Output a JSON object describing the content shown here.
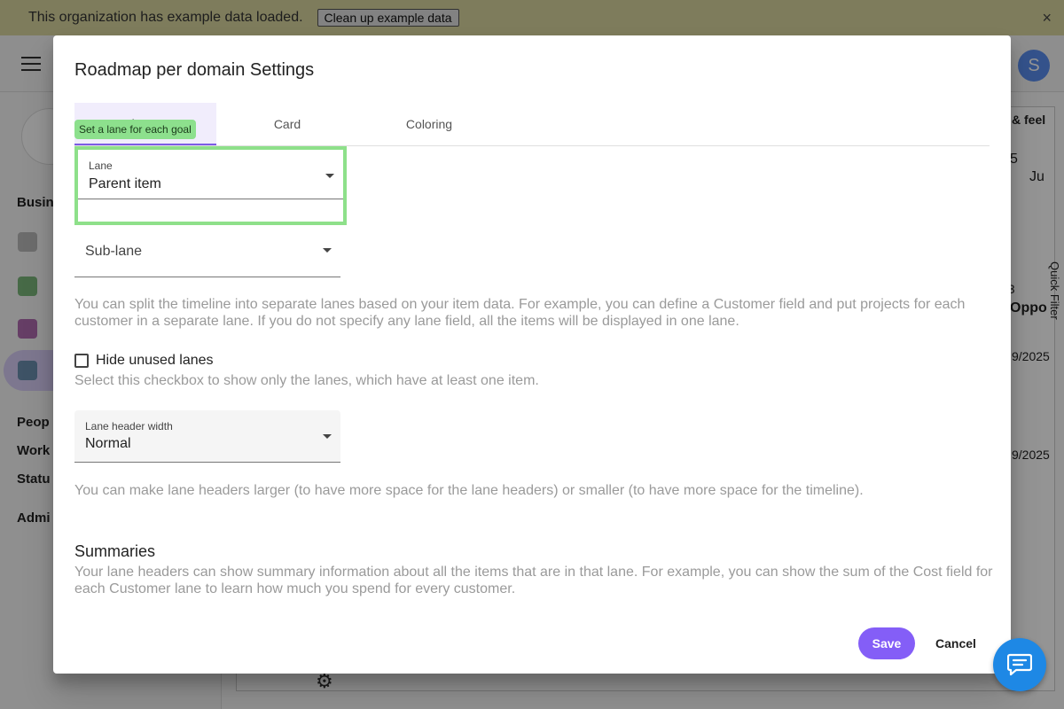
{
  "banner": {
    "message": "This organization has example data loaded.",
    "cleanup_label": "Clean up example data",
    "close_icon": "×"
  },
  "app": {
    "user_initial": "S",
    "sidebar_sections": [
      "Busin",
      "Peop",
      "Work",
      "Statu",
      "Admi"
    ],
    "gear_icon": "⚙",
    "background_labels": {
      "look_and_feel": "& feel",
      "year_fragment": "5",
      "month_fragment": "Ju",
      "quick_filter": "Quick Filter",
      "item_number": "#3",
      "item_title": "Oppo",
      "date_1": "9/2025",
      "date_2": "9/2025"
    }
  },
  "dialog": {
    "title": "Roadmap per domain Settings",
    "tabs": [
      {
        "label": "Lane",
        "active": true
      },
      {
        "label": "Card",
        "active": false
      },
      {
        "label": "Coloring",
        "active": false
      }
    ],
    "tooltip": "Set a lane for each goal",
    "lane": {
      "label": "Lane",
      "value": "Parent item"
    },
    "sub_lane": {
      "placeholder": "Sub-lane",
      "value": ""
    },
    "lane_help": "You can split the timeline into separate lanes based on your item data. For example, you can define a Customer field and put projects for each customer in a separate lane. If you do not specify any lane field, all the items will be displayed in one lane.",
    "hide_unused": {
      "label": "Hide unused lanes",
      "checked": false,
      "help": "Select this checkbox to show only the lanes, which have at least one item."
    },
    "header_width": {
      "label": "Lane header width",
      "value": "Normal"
    },
    "header_width_help": "You can make lane headers larger (to have more space for the lane headers) or smaller (to have more space for the timeline).",
    "summaries": {
      "title": "Summaries",
      "help": "Your lane headers can show summary information about all the items that are in that lane. For example, you can show the sum of the Cost field for each Customer lane to learn how much you spend for every customer."
    },
    "save_label": "Save",
    "cancel_label": "Cancel"
  },
  "colors": {
    "accent": "#845ef7",
    "highlight": "#8ee08a",
    "chat": "#1e88e5"
  }
}
